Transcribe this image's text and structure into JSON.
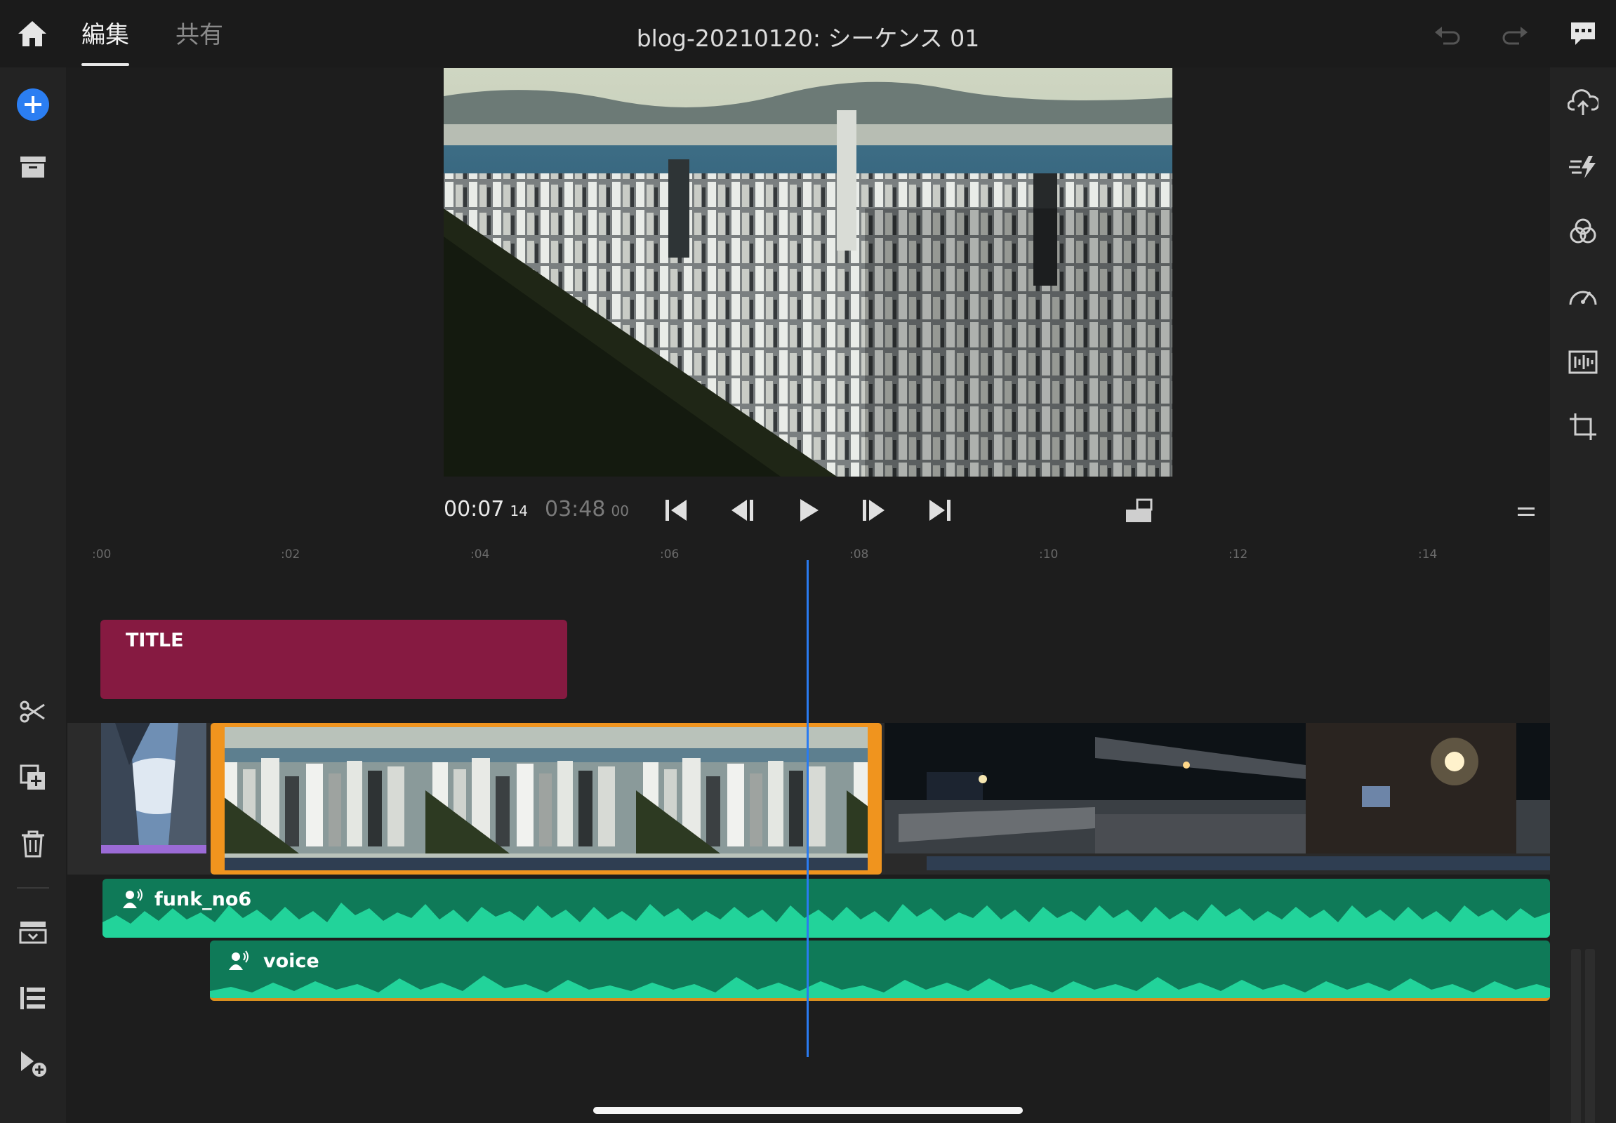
{
  "header": {
    "tabs": [
      {
        "label": "編集",
        "active": true
      },
      {
        "label": "共有",
        "active": false
      }
    ],
    "document_title": "blog-20210120: シーケンス 01"
  },
  "icons": {
    "top_left": "home-icon",
    "top_right": [
      "undo-icon",
      "redo-icon",
      "comment-icon"
    ],
    "left_rail": [
      "add-media-icon",
      "project-panel-icon",
      "split-clip-icon",
      "duplicate-clip-icon",
      "delete-clip-icon",
      "storyboard-icon",
      "tracks-list-icon",
      "add-track-icon"
    ],
    "right_rail": [
      "upload-cloud-icon",
      "transitions-icon",
      "color-icon",
      "speed-icon",
      "audio-icon",
      "crop-icon"
    ]
  },
  "transport": {
    "current_time": "00:07",
    "current_frames": "14",
    "duration_time": "03:48",
    "duration_frames": "00"
  },
  "timeline": {
    "ruler_labels": [
      ":00",
      ":02",
      ":04",
      ":06",
      ":08",
      ":10",
      ":12",
      ":14"
    ],
    "title_clip_label": "TITLE",
    "audio_tracks": [
      {
        "name": "funk_no6"
      },
      {
        "name": "voice"
      }
    ]
  },
  "colors": {
    "accent_blue": "#2a7bf0",
    "title_clip": "#861a41",
    "audio_track": "#1bbf8a",
    "selected_clip_border": "#f0941e"
  }
}
